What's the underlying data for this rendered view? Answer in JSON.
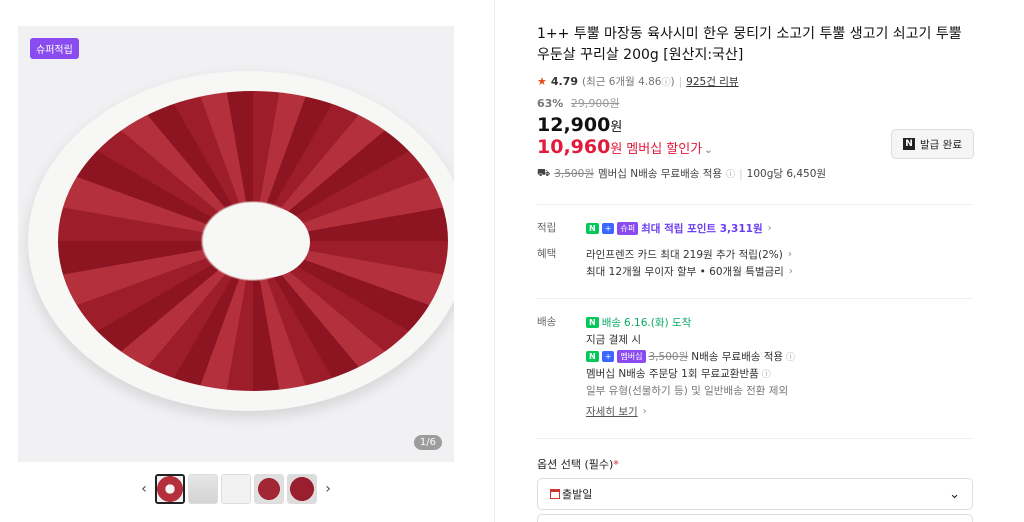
{
  "gallery": {
    "badge": "슈퍼적립",
    "counter": "1/6",
    "prev_icon": "chevron-left",
    "next_icon": "chevron-right"
  },
  "product": {
    "title": "1++ 투뿔 마장동 육사시미 한우 뭉티기 소고기 투뿔 생고기 쇠고기 투뿔 우둔살 꾸리살 200g [원산지:국산]",
    "rating": "4.79",
    "recent": "(최근 6개월 4.86",
    "reviews": "925건 리뷰",
    "discount_rate": "63%",
    "original_price": "29,900원",
    "price": "12,900",
    "price_unit": "원",
    "member_price": "10,960",
    "member_unit": "원",
    "member_label": "멤버십 할인가",
    "coupon_button": "발급 완료",
    "ship_old": "3,500원",
    "ship_text": "멤버십 N배송 무료배송 적용",
    "unit_price": "100g당 6,450원"
  },
  "points": {
    "label": "적립",
    "badge_n": "N",
    "badge_plus": "+",
    "badge_super": "슈퍼",
    "text": "최대 적립 포인트 3,311원"
  },
  "benefits": {
    "label": "혜택",
    "line1": "라인프렌즈 카드 최대 219원 추가 적립(2%)",
    "line2": "최대 12개월 무이자 할부 • 60개월 특별금리"
  },
  "delivery": {
    "label": "배송",
    "badge": "배송",
    "date": "6.16.(화) 도착",
    "line1": "지금 결제 시",
    "member_badge": "멤버십",
    "old_fee": "3,500원",
    "fee_text": "N배송 무료배송 적용",
    "line3": "멤버십 N배송 주문당 1회 무료교환반품",
    "line4": "일부 유형(선물하기 등) 및 일반배송 전환 제외",
    "more": "자세히 보기"
  },
  "options": {
    "label": "옵션 선택 (필수)",
    "required_mark": "*",
    "select_value": "출발일"
  }
}
